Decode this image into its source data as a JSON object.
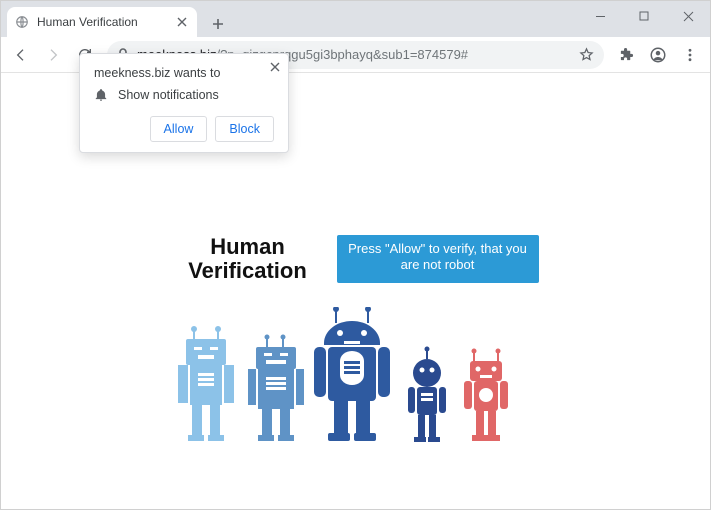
{
  "window": {
    "tab_title": "Human Verification"
  },
  "toolbar": {
    "url_host": "meekness.biz",
    "url_path": "/?p=gizgcnrqgu5gi3bphayq&sub1=874579#"
  },
  "permission": {
    "origin_line": "meekness.biz wants to",
    "capability": "Show notifications",
    "allow_label": "Allow",
    "block_label": "Block"
  },
  "page": {
    "heading_line1": "Human",
    "heading_line2": "Verification",
    "cta_text": "Press \"Allow\" to verify, that you are not robot"
  }
}
